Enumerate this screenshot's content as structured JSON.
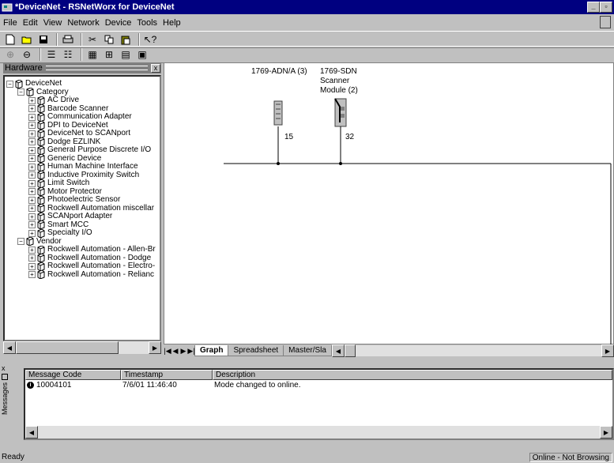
{
  "window": {
    "title": "*DeviceNet - RSNetWorx for DeviceNet"
  },
  "menu": [
    "File",
    "Edit",
    "View",
    "Network",
    "Device",
    "Tools",
    "Help"
  ],
  "hardware": {
    "title": "Hardware",
    "root": "DeviceNet",
    "category_label": "Category",
    "categories": [
      "AC Drive",
      "Barcode Scanner",
      "Communication Adapter",
      "DPI to DeviceNet",
      "DeviceNet to SCANport",
      "Dodge EZLINK",
      "General Purpose Discrete I/O",
      "Generic Device",
      "Human Machine Interface",
      "Inductive Proximity Switch",
      "Limit Switch",
      "Motor Protector",
      "Photoelectric Sensor",
      "Rockwell Automation miscellar",
      "SCANport Adapter",
      "Smart MCC",
      "Specialty I/O"
    ],
    "vendor_label": "Vendor",
    "vendors": [
      "Rockwell Automation - Allen-Br",
      "Rockwell Automation - Dodge",
      "Rockwell Automation - Electro-",
      "Rockwell Automation - Relianc"
    ]
  },
  "graph": {
    "devices": [
      {
        "label": "1769-ADN/A (3)",
        "address": "15"
      },
      {
        "label1": "1769-SDN",
        "label2": "Scanner",
        "label3": "Module (2)",
        "address": "32"
      }
    ]
  },
  "tabs": [
    "Graph",
    "Spreadsheet",
    "Master/Sla"
  ],
  "messages": {
    "side_label": "Messages",
    "columns": [
      "Message Code",
      "Timestamp",
      "Description"
    ],
    "rows": [
      {
        "code": "10004101",
        "timestamp": "7/6/01 11:46:40",
        "description": "Mode changed to online."
      }
    ]
  },
  "status": {
    "left": "Ready",
    "right": "Online - Not Browsing"
  },
  "colors": {
    "titlebar": "#000080",
    "face": "#c0c0c0"
  }
}
